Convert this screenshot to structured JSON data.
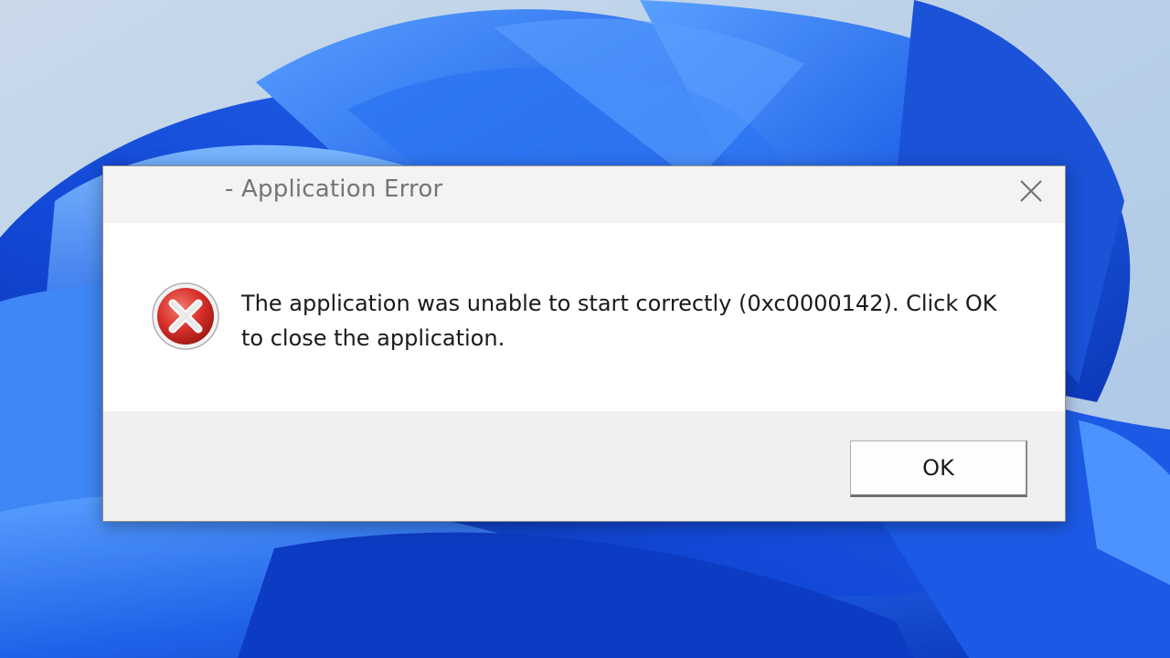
{
  "dialog": {
    "title": "- Application Error",
    "message": "The application was unable to start correctly (0xc0000142). Click OK to close the application.",
    "icon": "error-icon",
    "buttons": {
      "ok_label": "OK"
    },
    "close_icon": "close-icon"
  },
  "colors": {
    "wallpaper_blue": "#1f5fe0",
    "wallpaper_light": "#c4d6ea",
    "error_red": "#d9312b",
    "titlebar": "#f4f3f1",
    "footer": "#f0f0f0"
  }
}
